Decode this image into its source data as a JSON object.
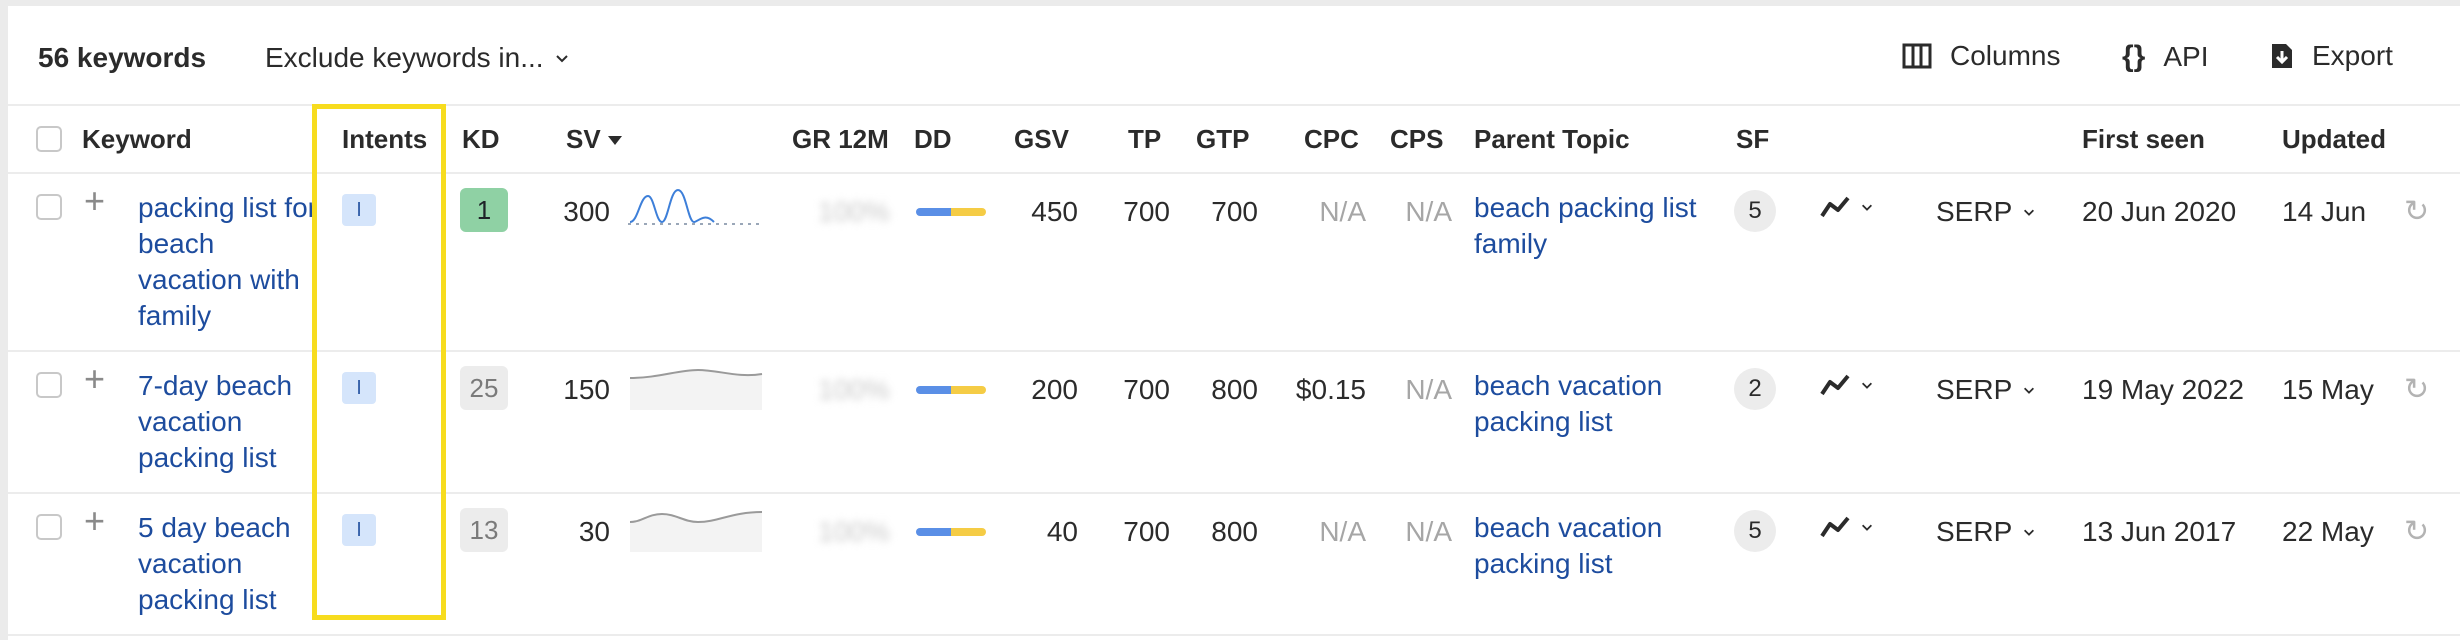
{
  "toolbar": {
    "keyword_count": "56 keywords",
    "exclude_label": "Exclude keywords in...",
    "columns_label": "Columns",
    "api_label": "API",
    "export_label": "Export"
  },
  "headers": {
    "keyword": "Keyword",
    "intents": "Intents",
    "kd": "KD",
    "sv": "SV",
    "gr12m": "GR 12M",
    "dd": "DD",
    "gsv": "GSV",
    "tp": "TP",
    "gtp": "GTP",
    "cpc": "CPC",
    "cps": "CPS",
    "parent_topic": "Parent Topic",
    "sf": "SF",
    "first_seen": "First seen",
    "updated": "Updated"
  },
  "rows": [
    {
      "keyword": "packing list for beach vacation with family",
      "intent": "I",
      "kd": "1",
      "kd_color": "#8fd1a4",
      "sv": "300",
      "gr": "100%",
      "gsv": "450",
      "tp": "700",
      "gtp": "700",
      "cpc": "N/A",
      "cps": "N/A",
      "parent_topic": "beach packing list family",
      "sf": "5",
      "serp": "SERP",
      "first_seen": "20 Jun 2020",
      "updated": "14 Jun"
    },
    {
      "keyword": "7-day beach vacation packing list",
      "intent": "I",
      "kd": "25",
      "kd_color": "#ececec",
      "sv": "150",
      "gr": "100%",
      "gsv": "200",
      "tp": "700",
      "gtp": "800",
      "cpc": "$0.15",
      "cps": "N/A",
      "parent_topic": "beach vacation packing list",
      "sf": "2",
      "serp": "SERP",
      "first_seen": "19 May 2022",
      "updated": "15 May"
    },
    {
      "keyword": "5 day beach vacation packing list",
      "intent": "I",
      "kd": "13",
      "kd_color": "#ececec",
      "sv": "30",
      "gr": "100%",
      "gsv": "40",
      "tp": "700",
      "gtp": "800",
      "cpc": "N/A",
      "cps": "N/A",
      "parent_topic": "beach vacation packing list",
      "sf": "5",
      "serp": "SERP",
      "first_seen": "13 Jun 2017",
      "updated": "22 May"
    }
  ],
  "colors": {
    "link": "#1d4c9e",
    "highlight": "#f7dc1e",
    "kd_easy": "#8fd1a4",
    "intent_bg": "#d5e5fb"
  },
  "icons": {
    "columns": "columns-icon",
    "api": "braces-icon",
    "export": "download-icon",
    "sort": "sort-desc-icon",
    "add": "plus-icon",
    "trend": "trend-icon",
    "refresh": "refresh-icon"
  }
}
